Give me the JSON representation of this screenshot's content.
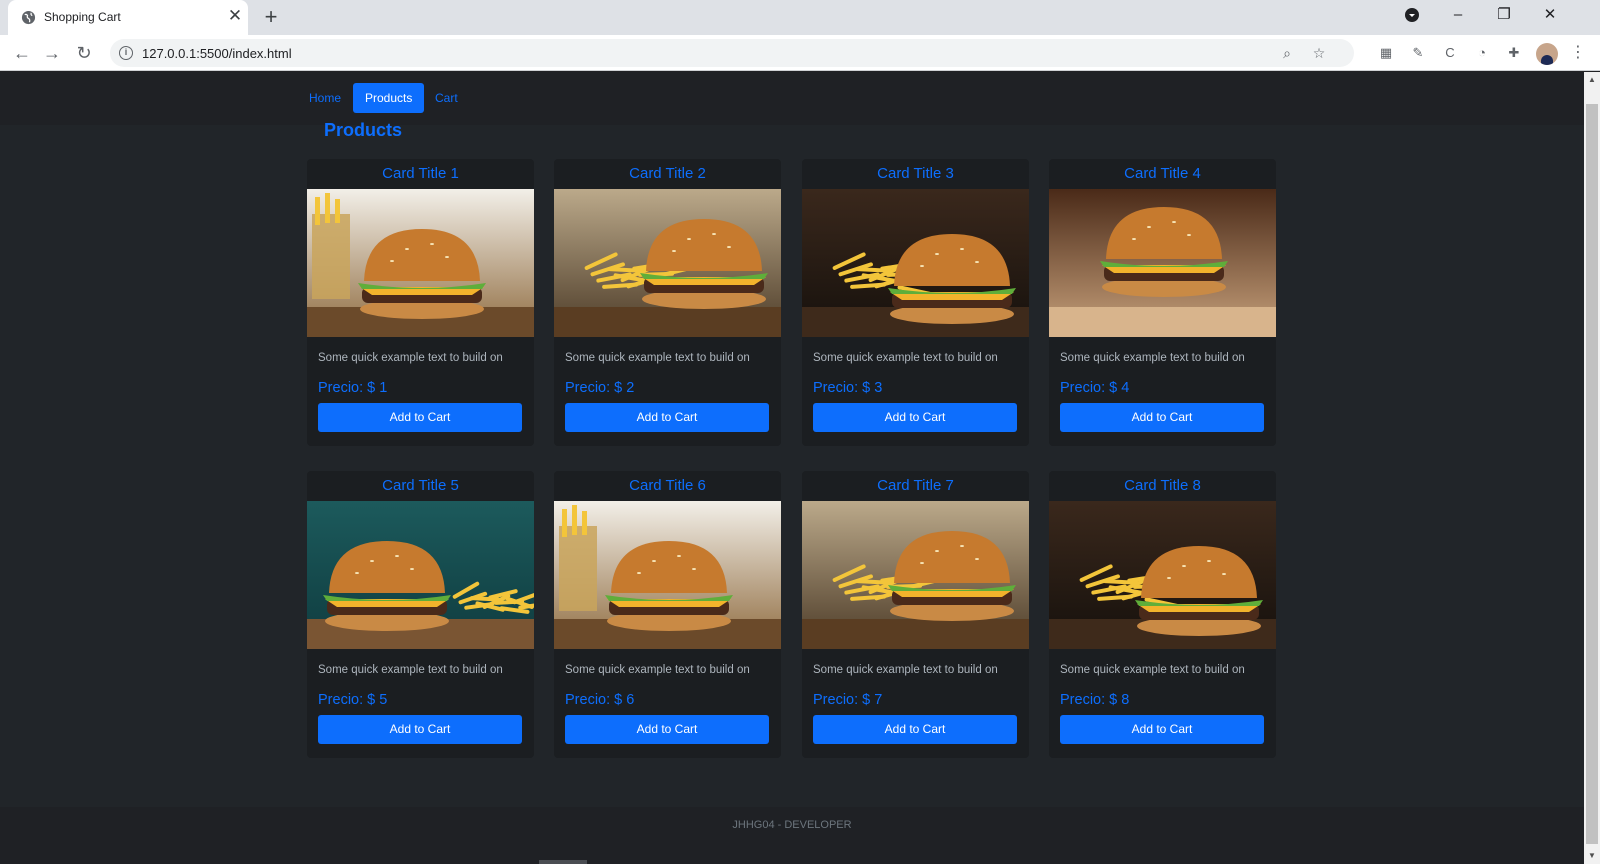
{
  "browser": {
    "tab_title": "Shopping Cart",
    "tab_close": "✕",
    "new_tab": "+",
    "url": "127.0.0.1:5500/index.html",
    "window_controls": [
      "–",
      "❐",
      "✕"
    ]
  },
  "nav": {
    "home": "Home",
    "products": "Products",
    "cart": "Cart"
  },
  "page_title": "Products",
  "products": [
    {
      "title": "Card Title 1",
      "text": "Some quick example text to build on",
      "price": "Precio: $ 1",
      "button": "Add to Cart",
      "image": "burger-fries-basket"
    },
    {
      "title": "Card Title 2",
      "text": "Some quick example text to build on",
      "price": "Precio: $ 2",
      "button": "Add to Cart",
      "image": "burger-fries-plate"
    },
    {
      "title": "Card Title 3",
      "text": "Some quick example text to build on",
      "price": "Precio: $ 3",
      "button": "Add to Cart",
      "image": "burger-fries-dark"
    },
    {
      "title": "Card Title 4",
      "text": "Some quick example text to build on",
      "price": "Precio: $ 4",
      "button": "Add to Cart",
      "image": "bacon-cheeseburger"
    },
    {
      "title": "Card Title 5",
      "text": "Some quick example text to build on",
      "price": "Precio: $ 5",
      "button": "Add to Cart",
      "image": "burger-teal-background"
    },
    {
      "title": "Card Title 6",
      "text": "Some quick example text to build on",
      "price": "Precio: $ 6",
      "button": "Add to Cart",
      "image": "burger-fries-basket"
    },
    {
      "title": "Card Title 7",
      "text": "Some quick example text to build on",
      "price": "Precio: $ 7",
      "button": "Add to Cart",
      "image": "burger-fries-plate"
    },
    {
      "title": "Card Title 8",
      "text": "Some quick example text to build on",
      "price": "Precio: $ 8",
      "button": "Add to Cart",
      "image": "burger-fries-dark"
    }
  ],
  "footer": "JHHG04 - DEVELOPER",
  "colors": {
    "accent": "#0d6efd",
    "page_bg": "#212529",
    "card_bg": "#1b1e21",
    "muted_text": "#adb5bd"
  }
}
